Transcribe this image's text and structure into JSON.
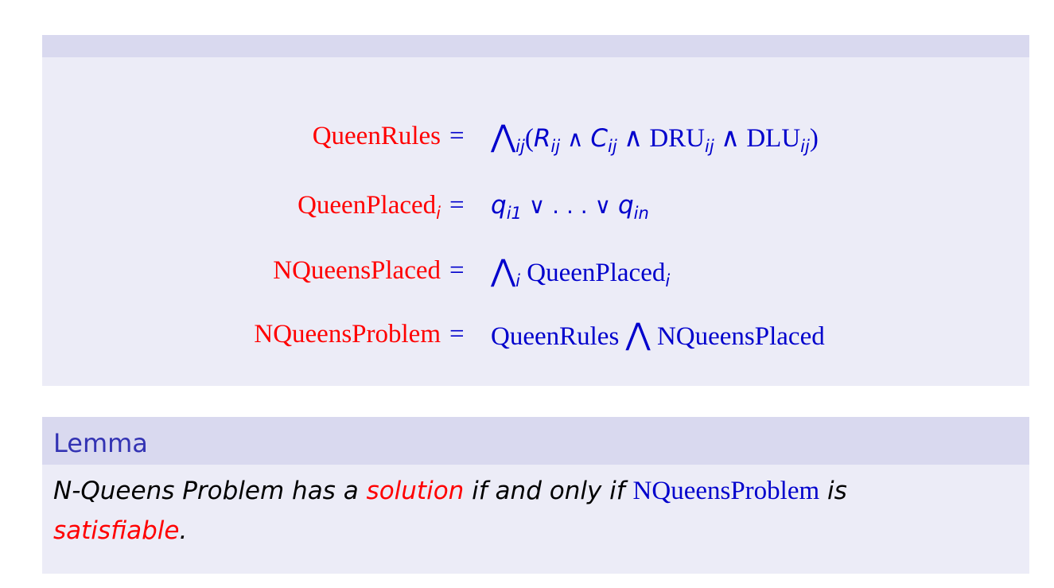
{
  "equations": [
    {
      "lhs": "QueenRules",
      "lhs_sub": "",
      "sign": "=",
      "rhs_parts": [
        "⋀",
        "ij",
        "(",
        "R",
        "ij",
        " ∧ ",
        "C",
        "ij",
        " ∧ DRU",
        "ij",
        " ∧ DLU",
        "ij",
        ")"
      ]
    },
    {
      "lhs": "QueenPlaced",
      "lhs_sub": "i",
      "sign": "=",
      "rhs_parts": [
        "q",
        "i1",
        " ∨ . . . ∨ ",
        "q",
        "in"
      ]
    },
    {
      "lhs": "NQueensPlaced",
      "lhs_sub": "",
      "sign": "=",
      "rhs_parts": [
        "⋀",
        "i",
        " QueenPlaced",
        "i"
      ]
    },
    {
      "lhs": "NQueensProblem",
      "lhs_sub": "",
      "sign": "=",
      "rhs_parts": [
        "QueenRules ",
        "⋀",
        " NQueensPlaced"
      ]
    }
  ],
  "lemma": {
    "title": "Lemma",
    "text_1": "N-Queens Problem has a ",
    "text_solution": "solution",
    "text_2": " if and only if ",
    "text_formula": "NQueensProblem",
    "text_3": " is",
    "text_satisfiable": "satisfiable",
    "text_4": "."
  },
  "colors": {
    "block_header": "#d9d9ef",
    "block_body": "#ececf7",
    "lhs_red": "#ff0000",
    "rhs_blue": "#0000cc",
    "title_blue": "#3333b3"
  }
}
